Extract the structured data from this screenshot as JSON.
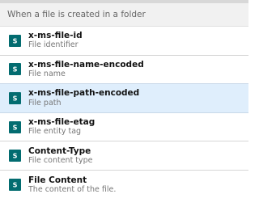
{
  "header": {
    "title": "When a file is created in a folder"
  },
  "colors": {
    "icon_bg": "#036c70",
    "selected_bg": "#dfeefc"
  },
  "items": [
    {
      "name": "x-ms-file-id",
      "description": "File identifier",
      "icon": "sharepoint-icon"
    },
    {
      "name": "x-ms-file-name-encoded",
      "description": "File name",
      "icon": "sharepoint-icon"
    },
    {
      "name": "x-ms-file-path-encoded",
      "description": "File path",
      "icon": "sharepoint-icon",
      "selected": true
    },
    {
      "name": "x-ms-file-etag",
      "description": "File entity tag",
      "icon": "sharepoint-icon"
    },
    {
      "name": "Content-Type",
      "description": "File content type",
      "icon": "sharepoint-icon"
    },
    {
      "name": "File Content",
      "description": "The content of the file.",
      "icon": "sharepoint-icon"
    }
  ]
}
